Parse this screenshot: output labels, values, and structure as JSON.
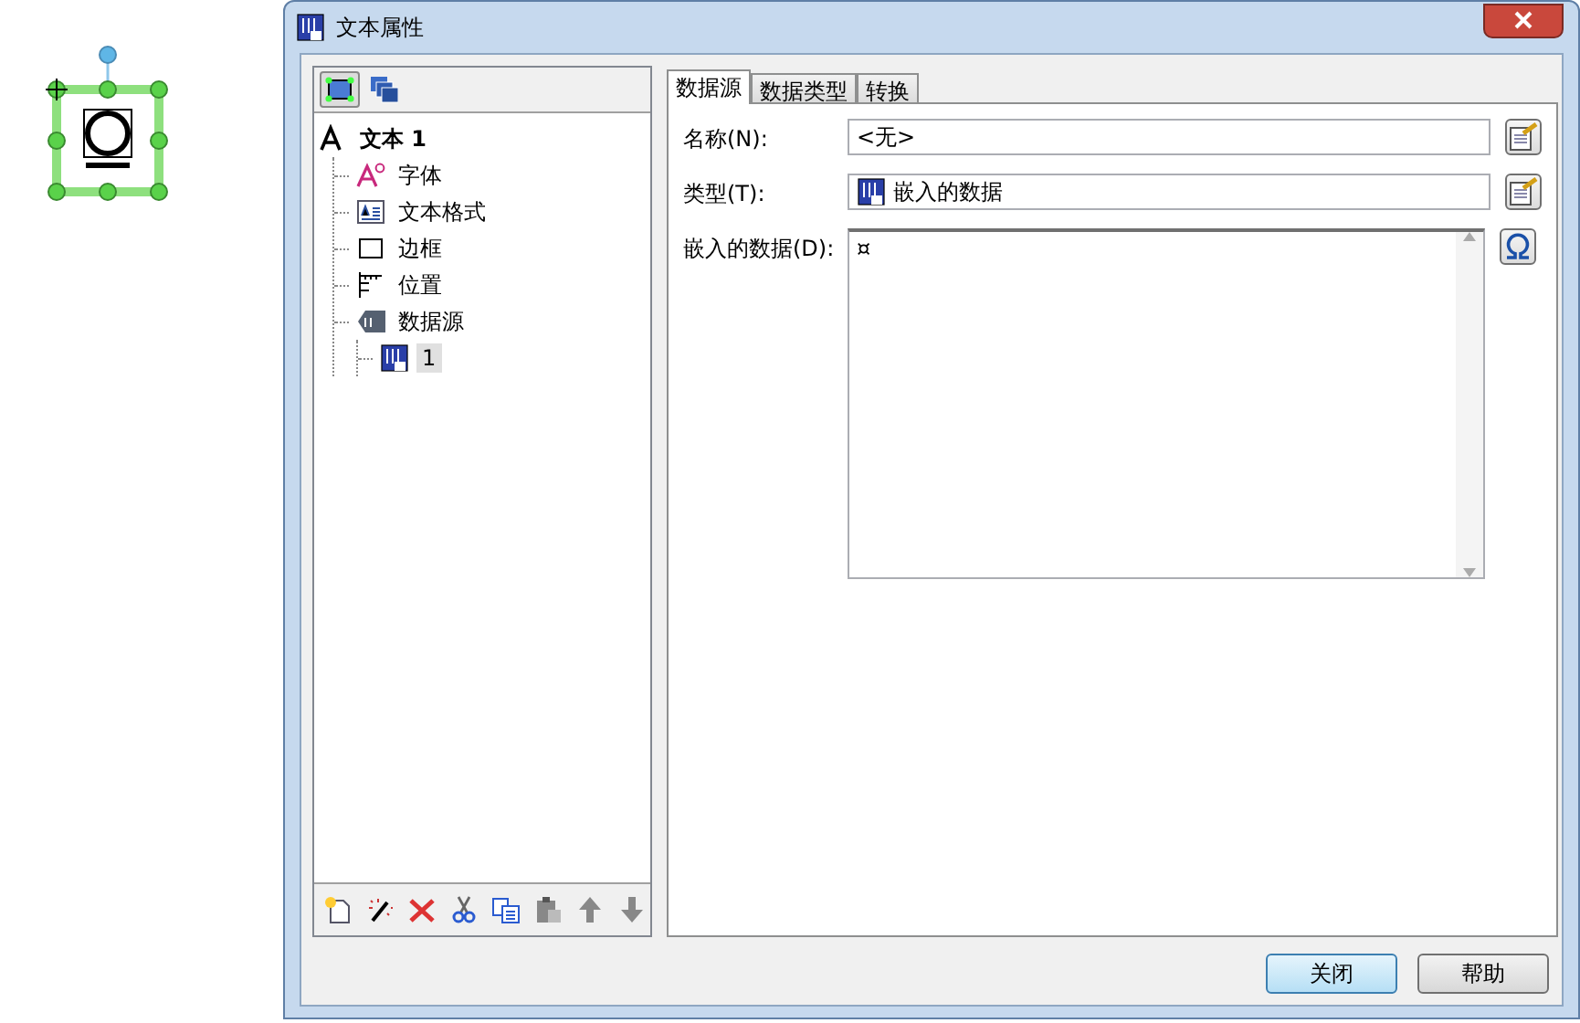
{
  "window": {
    "title": "文本属性"
  },
  "tree": [
    {
      "label": "文本 1",
      "kind": "text",
      "selected": false,
      "children": [
        {
          "label": "字体",
          "kind": "font",
          "selected": false
        },
        {
          "label": "文本格式",
          "kind": "format",
          "selected": false
        },
        {
          "label": "边框",
          "kind": "border",
          "selected": false
        },
        {
          "label": "位置",
          "kind": "position",
          "selected": false
        },
        {
          "label": "数据源",
          "kind": "datasource",
          "selected": false,
          "children": [
            {
              "label": "1",
              "kind": "embedded",
              "selected": true
            }
          ]
        }
      ]
    }
  ],
  "tabs": [
    {
      "label": "数据源",
      "selected": true
    },
    {
      "label": "数据类型",
      "selected": false
    },
    {
      "label": "转换",
      "selected": false
    }
  ],
  "fields": [
    {
      "label": "名称(N):",
      "kind": "text",
      "value": "<无>"
    },
    {
      "label": "类型(T):",
      "kind": "type",
      "value": "嵌入的数据"
    },
    {
      "label": "嵌入的数据(D):",
      "kind": "multiline",
      "value": "¤"
    }
  ],
  "buttons": [
    {
      "label": "关闭",
      "default": true
    },
    {
      "label": "帮助",
      "default": false
    }
  ]
}
